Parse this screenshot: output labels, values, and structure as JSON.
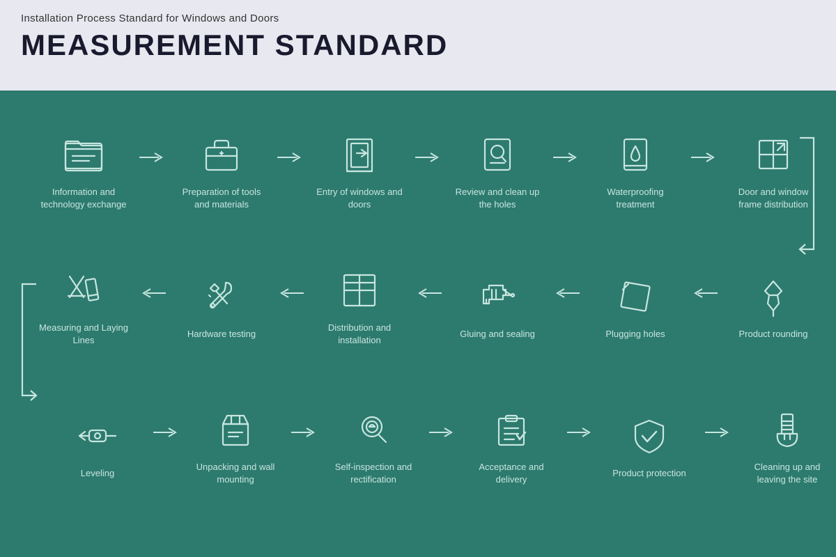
{
  "header": {
    "subtitle": "Installation Process Standard for Windows and Doors",
    "title": "MEASUREMENT STANDARD"
  },
  "rows": [
    {
      "id": "row1",
      "direction": "ltr",
      "steps": [
        {
          "id": "step1",
          "label": "Information and technology exchange",
          "icon": "folder"
        },
        {
          "id": "step2",
          "label": "Preparation of tools and materials",
          "icon": "tools-bag"
        },
        {
          "id": "step3",
          "label": "Entry of windows and doors",
          "icon": "door-frame"
        },
        {
          "id": "step4",
          "label": "Review and clean up the holes",
          "icon": "magnify"
        },
        {
          "id": "step5",
          "label": "Waterproofing treatment",
          "icon": "waterproof"
        },
        {
          "id": "step6",
          "label": "Door and window frame distribution",
          "icon": "window-arrow"
        }
      ]
    },
    {
      "id": "row2",
      "direction": "rtl",
      "steps": [
        {
          "id": "step7",
          "label": "Measuring and Laying Lines",
          "icon": "cross-ruler"
        },
        {
          "id": "step8",
          "label": "Hardware testing",
          "icon": "wrench"
        },
        {
          "id": "step9",
          "label": "Distribution and installation",
          "icon": "grid-box"
        },
        {
          "id": "step10",
          "label": "Gluing and sealing",
          "icon": "glue-gun"
        },
        {
          "id": "step11",
          "label": "Plugging holes",
          "icon": "diamond-frame"
        },
        {
          "id": "step12",
          "label": "Product rounding",
          "icon": "pushpin"
        }
      ]
    },
    {
      "id": "row3",
      "direction": "ltr",
      "steps": [
        {
          "id": "step13",
          "label": "Leveling",
          "icon": "level"
        },
        {
          "id": "step14",
          "label": "Unpacking and wall mounting",
          "icon": "unpack"
        },
        {
          "id": "step15",
          "label": "Self-inspection and rectification",
          "icon": "inspect"
        },
        {
          "id": "step16",
          "label": "Acceptance and delivery",
          "icon": "accept"
        },
        {
          "id": "step17",
          "label": "Product protection",
          "icon": "shield"
        },
        {
          "id": "step18",
          "label": "Cleaning up and leaving the site",
          "icon": "broom"
        }
      ]
    }
  ],
  "colors": {
    "bg": "#2d7a6e",
    "header_bg": "#e8e8f0",
    "icon_stroke": "#c8e6e0",
    "text": "#c8e6e0"
  }
}
